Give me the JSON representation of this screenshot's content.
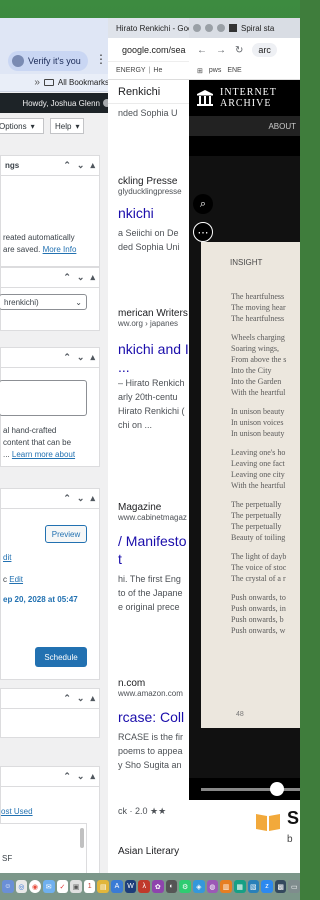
{
  "wp": {
    "verify": "Verify it's you",
    "bookmarks": "All Bookmarks",
    "user": "Howdy, Joshua Glenn",
    "options": "Options",
    "help": "Help",
    "panel1": {
      "title": "ngs",
      "text1": "reated automatically",
      "text2": "are saved.",
      "link": "More Info"
    },
    "panel2": {
      "select": "hrenkichi)"
    },
    "panel3": {
      "text1": "al hand-crafted",
      "text2": "content that can be",
      "text3": "...",
      "link": "Learn more about"
    },
    "panel4": {
      "preview": "Preview",
      "edit1": "dit",
      "edit2_prefix": "c",
      "edit2": "Edit",
      "date": "ep 20, 2028 at 05:47",
      "schedule": "Schedule"
    },
    "panel5": {
      "tab": "ost Used",
      "line": "SF"
    }
  },
  "google": {
    "tab": "Hirato Renkichi - Google",
    "url": "google.com/sea",
    "bm": [
      "ENERGY",
      "He"
    ],
    "query": "Renkichi",
    "results": [
      {
        "src": "nded Sophia U",
        "url": "",
        "title": "",
        "snip": []
      },
      {
        "src": "ckling Presse",
        "url": "glyducklingpresse",
        "title": "nkichi",
        "snip": [
          "a Seiichi on De",
          "ded Sophia Uni"
        ]
      },
      {
        "src": "merican Writers",
        "url": "ww.org › japanes",
        "title": "nkichi and I",
        "snip": [
          "...",
          "– Hirato Renkich",
          "arly 20th-centu",
          "Hirato Renkichi (",
          "chi on ..."
        ]
      },
      {
        "src": "Magazine",
        "url": "www.cabinetmagaz",
        "title": "/ Manifesto",
        "title2": "t",
        "snip": [
          "hi. The first Eng",
          "to of the Japane",
          "e original prece"
        ]
      },
      {
        "src": "n.com",
        "url": "www.amazon.com",
        "title": "rcase: Coll",
        "snip": [
          "RCASE is the fir",
          "poems to appea",
          "y Sho Sugita an"
        ]
      },
      {
        "src": "",
        "url": "",
        "title": "",
        "snip": [
          "ck · 2.0 ★★"
        ]
      },
      {
        "src": "Asian Literary",
        "url": "",
        "title": "",
        "snip": []
      }
    ]
  },
  "ia": {
    "tab": "Spiral sta",
    "url": "arc",
    "bm": [
      "pws",
      "ENE"
    ],
    "logo1": "INTERNET",
    "logo2": "ARCHIVE",
    "about": "ABOUT",
    "heading": "INSIGHT",
    "lines": [
      "The heartfulness",
      "The moving hear",
      "The heartfulness",
      "",
      "Wheels charging",
      "Soaring wings,",
      "From above the s",
      "Into the City",
      "Into the Garden",
      "With the heartful",
      "",
      "In unison beauty",
      "In unison voices",
      "In unison beauty",
      "",
      "Leaving one's ho",
      "Leaving one fact",
      "Leaving one city",
      "With the heartful",
      "",
      "The perpetually",
      "The perpetually",
      "The perpetually",
      "Beauty of toiling",
      "",
      "The light of dayb",
      "The voice of stoc",
      "The crystal of a r",
      "",
      "Push onwards, to",
      "Push onwards, in",
      "Push onwards, b",
      "Push onwards, w"
    ],
    "page_number": "48",
    "foot_letter": "S",
    "foot_letter2": "b",
    "slider_fraction": 0.77
  }
}
